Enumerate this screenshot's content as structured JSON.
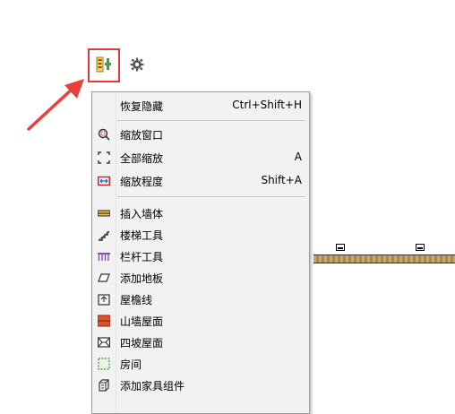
{
  "toolbar": {
    "tool_icon": "plan-tool-icon",
    "settings_icon": "gear-icon"
  },
  "menu": {
    "groups": [
      [
        {
          "label": "恢复隐藏",
          "shortcut": "Ctrl+Shift+H",
          "icon": "none"
        }
      ],
      [
        {
          "label": "缩放窗口",
          "shortcut": "",
          "icon": "zoom-window-icon"
        },
        {
          "label": "全部缩放",
          "shortcut": "A",
          "icon": "zoom-all-icon"
        },
        {
          "label": "缩放程度",
          "shortcut": "Shift+A",
          "icon": "zoom-extent-icon"
        }
      ],
      [
        {
          "label": "插入墙体",
          "shortcut": "",
          "icon": "wall-icon"
        },
        {
          "label": "楼梯工具",
          "shortcut": "",
          "icon": "stairs-icon"
        },
        {
          "label": "栏杆工具",
          "shortcut": "",
          "icon": "railing-icon"
        },
        {
          "label": "添加地板",
          "shortcut": "",
          "icon": "floor-icon"
        },
        {
          "label": "屋檐线",
          "shortcut": "",
          "icon": "eave-icon"
        },
        {
          "label": "山墙屋面",
          "shortcut": "",
          "icon": "gable-roof-icon"
        },
        {
          "label": "四坡屋面",
          "shortcut": "",
          "icon": "hip-roof-icon"
        },
        {
          "label": "房间",
          "shortcut": "",
          "icon": "room-icon"
        },
        {
          "label": "添加家具组件",
          "shortcut": "",
          "icon": "furniture-icon"
        }
      ]
    ]
  },
  "colors": {
    "highlight_border": "#e33a36",
    "menu_bg": "#f2f2f2",
    "wall": "#c8a96b"
  }
}
